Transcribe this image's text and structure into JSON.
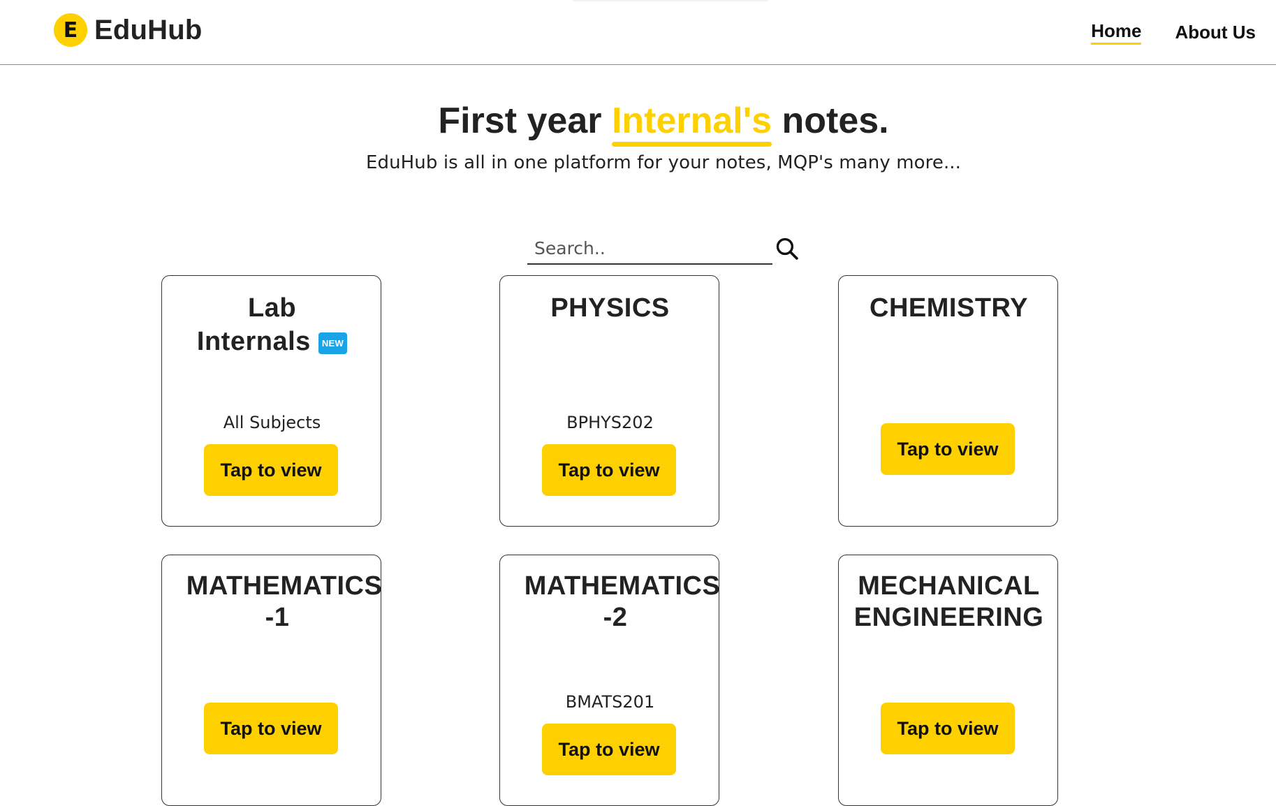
{
  "header": {
    "logo_letter": "E",
    "brand": "EduHub",
    "nav": [
      {
        "label": "Home",
        "active": true
      },
      {
        "label": "About Us",
        "active": false
      }
    ]
  },
  "hero": {
    "title_part1": "First year ",
    "title_highlight": "Internal's",
    "title_part2": " notes.",
    "subtitle": "EduHub is all in one platform for your notes, MQP's many more..."
  },
  "search": {
    "placeholder": "Search..",
    "icon": "search-icon"
  },
  "cards": [
    {
      "title_line1": "Lab",
      "title_line2": "Internals",
      "badge": "NEW",
      "code": "All Subjects",
      "button": "Tap to view"
    },
    {
      "title": "PHYSICS",
      "code": "BPHYS202",
      "button": "Tap to view"
    },
    {
      "title": "CHEMISTRY",
      "code": "",
      "button": "Tap to view"
    },
    {
      "title_line1": "MATHEMATICS",
      "title_line2": "-1",
      "code": "",
      "button": "Tap to view"
    },
    {
      "title_line1": "MATHEMATICS",
      "title_line2": "-2",
      "code": "BMATS201",
      "button": "Tap to view"
    },
    {
      "title_line1": "MECHANICAL",
      "title_line2": "ENGINEERING",
      "code": "",
      "button": "Tap to view"
    }
  ],
  "colors": {
    "accent": "#ffd000",
    "badge": "#1ba3e8",
    "text": "#222222"
  }
}
